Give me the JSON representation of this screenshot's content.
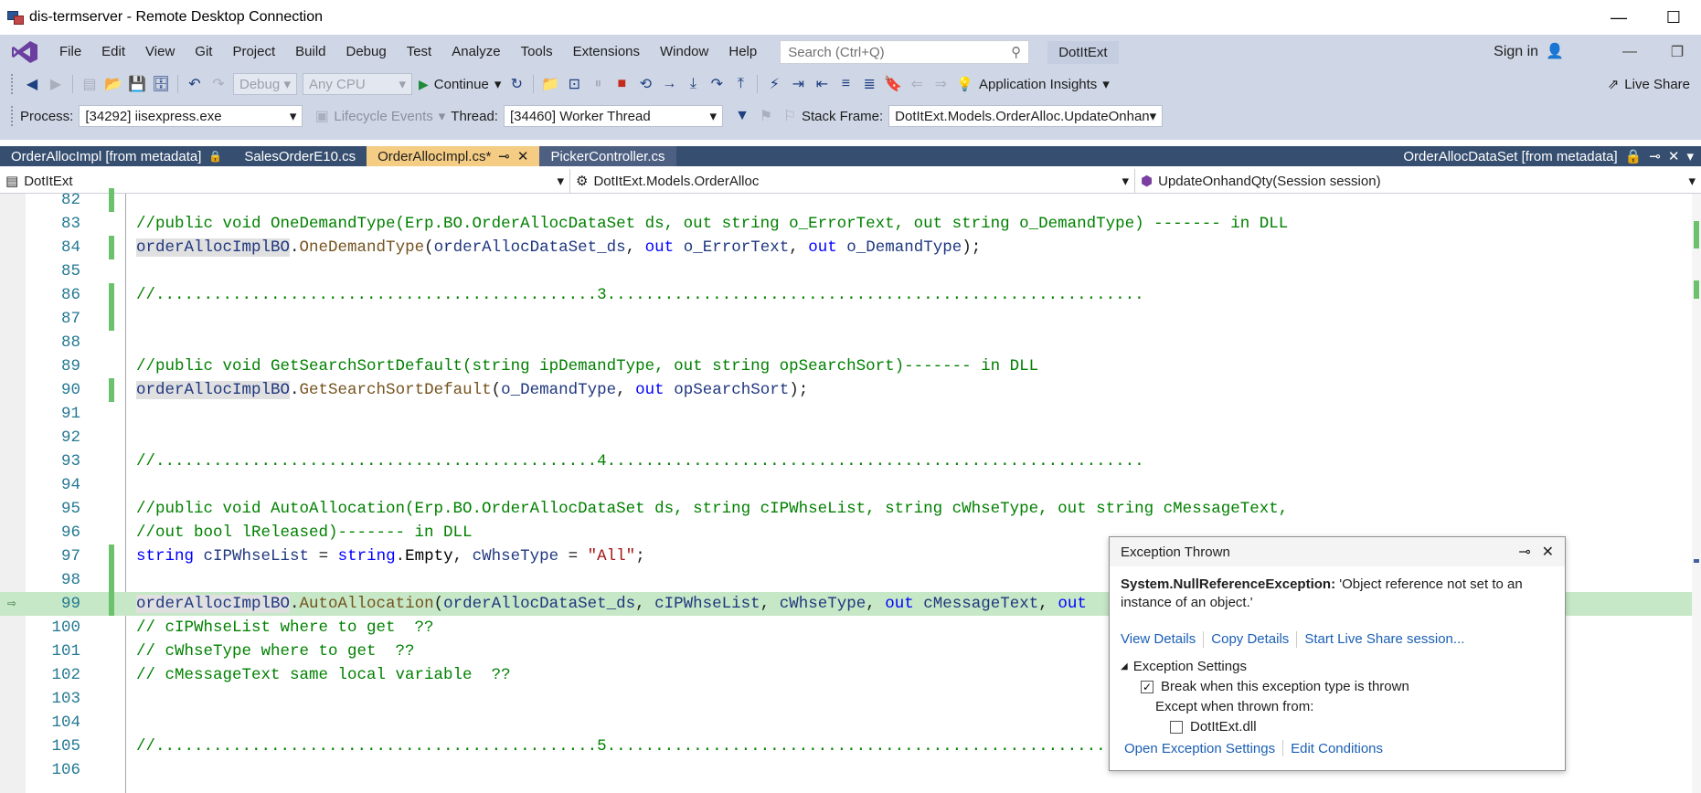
{
  "rdp": {
    "title": "dis-termserver - Remote Desktop Connection",
    "minimize": "—",
    "maximize": "☐"
  },
  "menu": {
    "items": [
      "File",
      "Edit",
      "View",
      "Git",
      "Project",
      "Build",
      "Debug",
      "Test",
      "Analyze",
      "Tools",
      "Extensions",
      "Window",
      "Help"
    ],
    "search_placeholder": "Search (Ctrl+Q)",
    "solution_name": "DotItExt",
    "sign_in": "Sign in"
  },
  "toolbar1": {
    "config": "Debug",
    "platform": "Any CPU",
    "continue": "Continue",
    "app_insights": "Application Insights",
    "live_share": "Live Share"
  },
  "toolbar2": {
    "process_label": "Process:",
    "process_value": "[34292] iisexpress.exe",
    "lifecycle": "Lifecycle Events",
    "thread_label": "Thread:",
    "thread_value": "[34460] Worker Thread",
    "stack_label": "Stack Frame:",
    "stack_value": "DotItExt.Models.OrderAlloc.UpdateOnhan"
  },
  "tabs": [
    {
      "label": "OrderAllocImpl [from metadata]",
      "state": "pinned"
    },
    {
      "label": "SalesOrderE10.cs",
      "state": "normal"
    },
    {
      "label": "OrderAllocImpl.cs*",
      "state": "active"
    },
    {
      "label": "PickerController.cs",
      "state": "hover"
    }
  ],
  "tab_right": {
    "label": "OrderAllocDataSet [from metadata]"
  },
  "navbar": {
    "project": "DotItExt",
    "type": "DotItExt.Models.OrderAlloc",
    "member": "UpdateOnhandQty(Session session)"
  },
  "code": {
    "lines": [
      {
        "n": "82",
        "changed": true,
        "text": ""
      },
      {
        "n": "83",
        "changed": false,
        "text": "//public void OneDemandType(Erp.BO.OrderAllocDataSet ds, out string o_ErrorText, out string o_DemandType) ------- in DLL"
      },
      {
        "n": "84",
        "changed": true,
        "text": "orderAllocImplBO.OneDemandType(orderAllocDataSet_ds, out o_ErrorText, out o_DemandType);"
      },
      {
        "n": "85",
        "changed": false,
        "text": ""
      },
      {
        "n": "86",
        "changed": true,
        "text": "//..............................................3........................................................"
      },
      {
        "n": "87",
        "changed": true,
        "text": ""
      },
      {
        "n": "88",
        "changed": false,
        "text": ""
      },
      {
        "n": "89",
        "changed": false,
        "text": "//public void GetSearchSortDefault(string ipDemandType, out string opSearchSort)------- in DLL"
      },
      {
        "n": "90",
        "changed": true,
        "text": "orderAllocImplBO.GetSearchSortDefault(o_DemandType, out opSearchSort);"
      },
      {
        "n": "91",
        "changed": false,
        "text": ""
      },
      {
        "n": "92",
        "changed": false,
        "text": ""
      },
      {
        "n": "93",
        "changed": false,
        "text": "//..............................................4........................................................"
      },
      {
        "n": "94",
        "changed": false,
        "text": ""
      },
      {
        "n": "95",
        "changed": false,
        "text": "//public void AutoAllocation(Erp.BO.OrderAllocDataSet ds, string cIPWhseList, string cWhseType, out string cMessageText,"
      },
      {
        "n": "96",
        "changed": false,
        "text": "//out bool lReleased)------- in DLL"
      },
      {
        "n": "97",
        "changed": true,
        "text": "string cIPWhseList = string.Empty, cWhseType = \"All\";"
      },
      {
        "n": "98",
        "changed": true,
        "text": ""
      },
      {
        "n": "99",
        "changed": true,
        "text": "orderAllocImplBO.AutoAllocation(orderAllocDataSet_ds, cIPWhseList, cWhseType, out cMessageText, out"
      },
      {
        "n": "100",
        "changed": false,
        "text": "// cIPWhseList where to get  ??"
      },
      {
        "n": "101",
        "changed": false,
        "text": "// cWhseType where to get  ??"
      },
      {
        "n": "102",
        "changed": false,
        "text": "// cMessageText same local variable  ??"
      },
      {
        "n": "103",
        "changed": false,
        "text": ""
      },
      {
        "n": "104",
        "changed": false,
        "text": ""
      },
      {
        "n": "105",
        "changed": false,
        "text": "//..............................................5...................................................."
      },
      {
        "n": "106",
        "changed": false,
        "text": ""
      }
    ]
  },
  "exception": {
    "title": "Exception Thrown",
    "type": "System.NullReferenceException:",
    "message": " 'Object reference not set to an instance of an object.'",
    "links": [
      "View Details",
      "Copy Details",
      "Start Live Share session..."
    ],
    "settings_header": "Exception Settings",
    "break_label": "Break when this exception type is thrown",
    "break_checked": true,
    "except_label": "Except when thrown from:",
    "dll_label": "DotItExt.dll",
    "dll_checked": false,
    "bottom_links": [
      "Open Exception Settings",
      "Edit Conditions"
    ]
  }
}
